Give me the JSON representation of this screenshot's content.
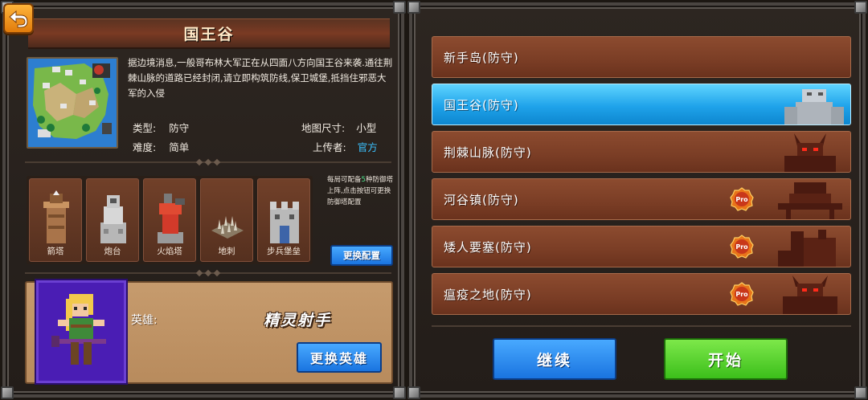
{
  "left": {
    "title": "国王谷",
    "description": "据边境消息,一般哥布林大军正在从四面八方向国王谷来袭.通往荆棘山脉的道路已经封闭,请立即构筑防线,保卫城堡,抵挡住邪恶大军的入侵",
    "info": {
      "type_label": "类型:",
      "type_value": "防守",
      "difficulty_label": "难度:",
      "difficulty_value": "简单",
      "mapsize_label": "地图尺寸:",
      "mapsize_value": "小型",
      "uploader_label": "上传者:",
      "uploader_value": "官方"
    },
    "towers": [
      {
        "label": "箭塔",
        "icon": "arrow-tower-icon"
      },
      {
        "label": "炮台",
        "icon": "cannon-tower-icon"
      },
      {
        "label": "火焰塔",
        "icon": "flame-tower-icon"
      },
      {
        "label": "地刺",
        "icon": "spike-trap-icon"
      },
      {
        "label": "步兵堡垒",
        "icon": "infantry-fort-icon"
      }
    ],
    "tower_note": {
      "pre": "每局可配备",
      "count": "5",
      "post": "种防御塔上阵,点击按钮可更换防御塔配置"
    },
    "change_config_label": "更换配置",
    "hero": {
      "label": "英雄:",
      "name": "精灵射手",
      "change_label": "更换英雄"
    }
  },
  "right": {
    "levels": [
      {
        "name": "新手岛(防守)",
        "selected": false,
        "pro": false
      },
      {
        "name": "国王谷(防守)",
        "selected": true,
        "pro": false
      },
      {
        "name": "荆棘山脉(防守)",
        "selected": false,
        "pro": false
      },
      {
        "name": "河谷镇(防守)",
        "selected": false,
        "pro": true
      },
      {
        "name": "矮人要塞(防守)",
        "selected": false,
        "pro": true
      },
      {
        "name": "瘟疫之地(防守)",
        "selected": false,
        "pro": true
      }
    ],
    "pro_badge": "Pro",
    "continue_label": "继续",
    "start_label": "开始"
  },
  "colors": {
    "selected_level": "#1fa3ea",
    "level_bg": "#7a3d25",
    "uploader_accent": "#3bc2ff",
    "pro_badge": "#e8741a",
    "start_button": "#3cbf1b",
    "continue_button": "#1a74e0"
  }
}
